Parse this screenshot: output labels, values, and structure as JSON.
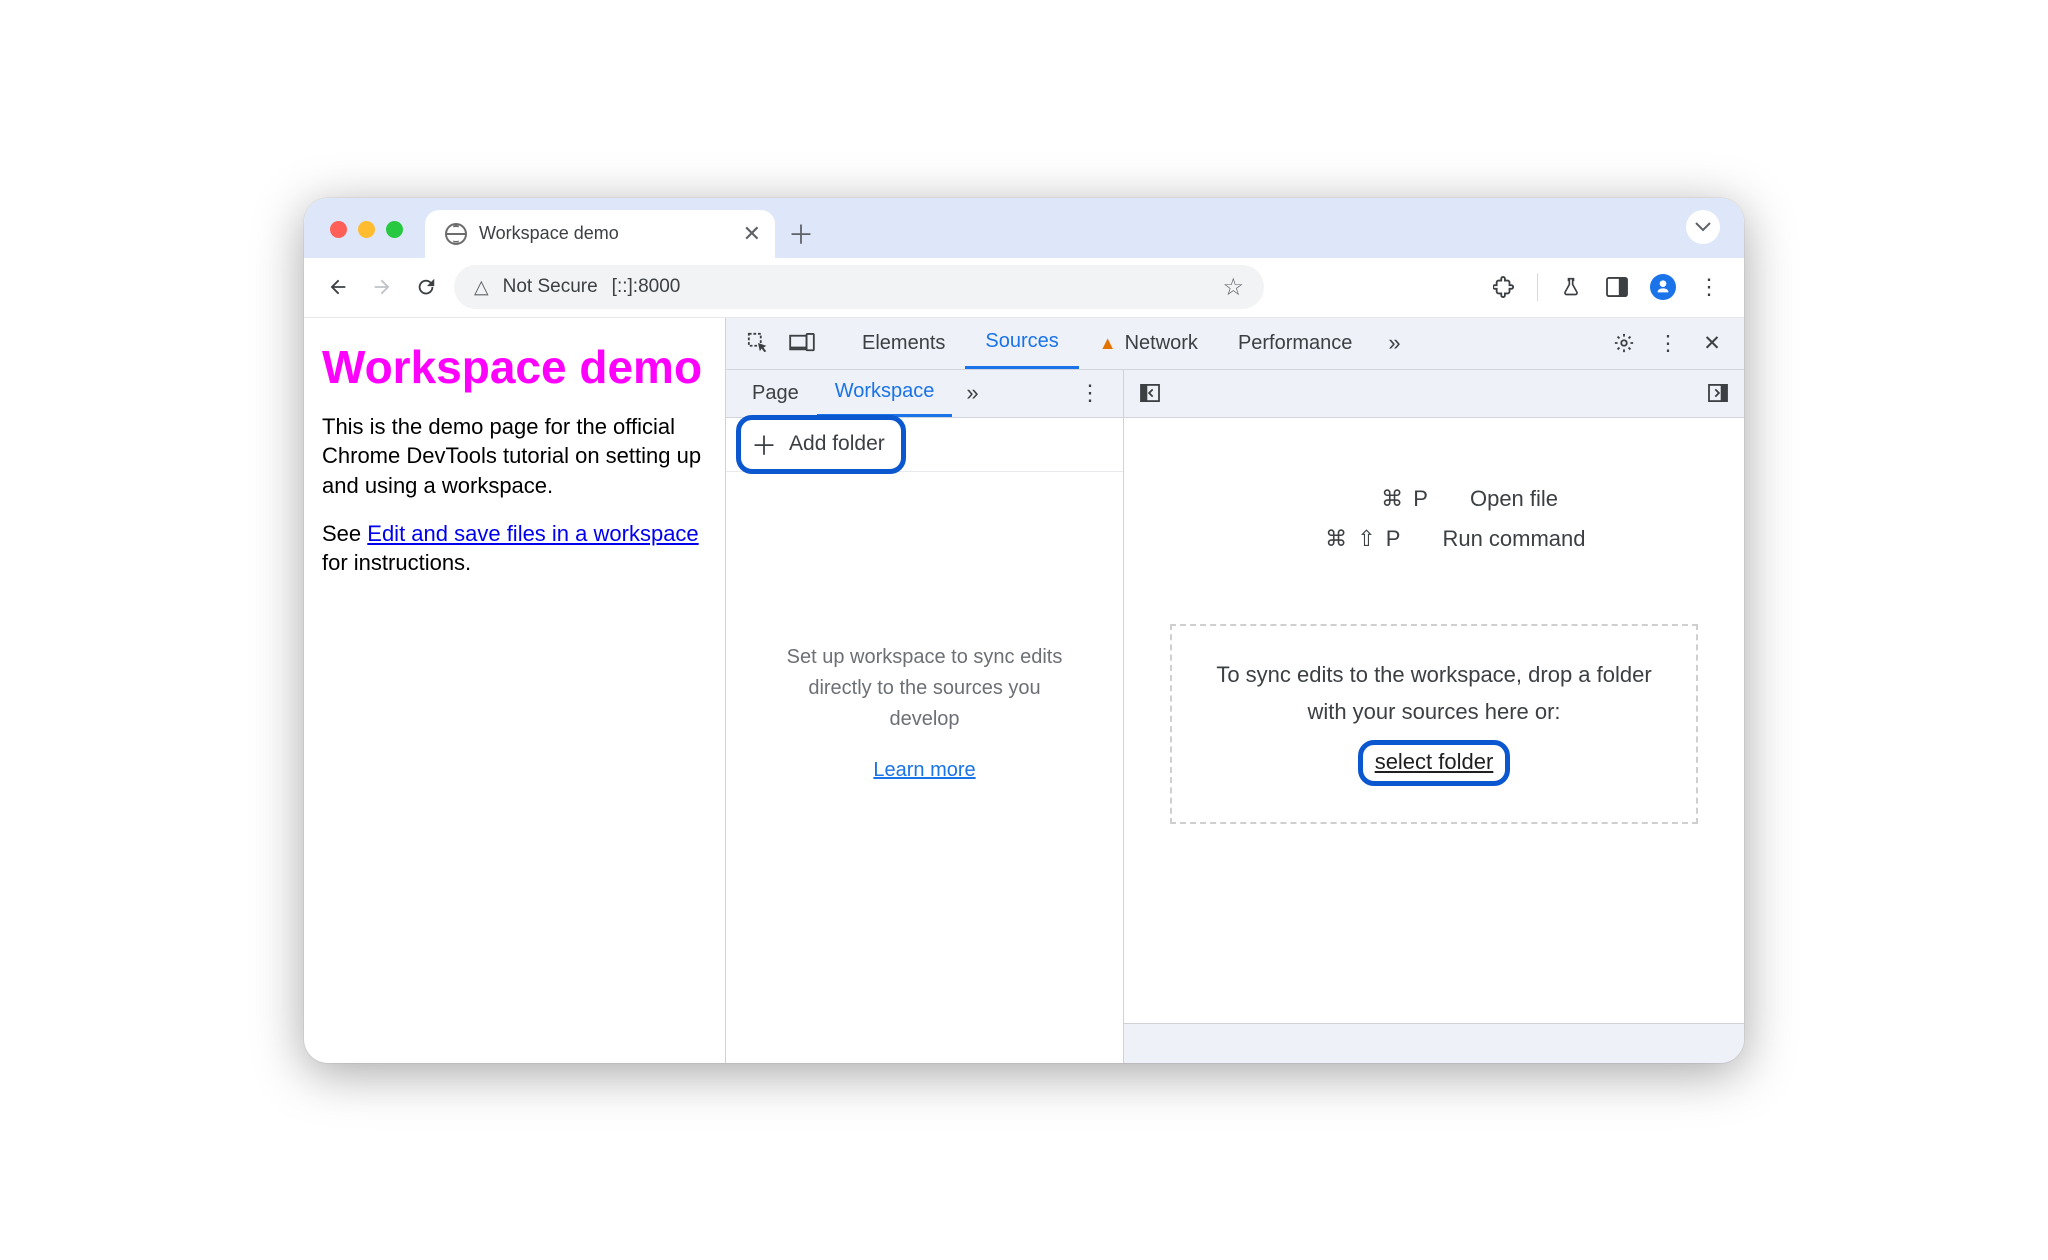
{
  "browser": {
    "tab_title": "Workspace demo",
    "security_label": "Not Secure",
    "url": "[::]:8000"
  },
  "page": {
    "heading": "Workspace demo",
    "para1": "This is the demo page for the official Chrome DevTools tutorial on setting up and using a workspace.",
    "para2_prefix": "See ",
    "para2_link": "Edit and save files in a workspace",
    "para2_suffix": " for instructions."
  },
  "devtools": {
    "tabs": {
      "elements": "Elements",
      "sources": "Sources",
      "network": "Network",
      "performance": "Performance"
    },
    "navigator": {
      "page_tab": "Page",
      "workspace_tab": "Workspace",
      "add_folder": "Add folder",
      "help_text": "Set up workspace to sync edits directly to the sources you develop",
      "learn_more": "Learn more"
    },
    "editor": {
      "open_file_shortcut": "⌘  P",
      "open_file_label": "Open file",
      "run_cmd_shortcut": "⌘  ⇧  P",
      "run_cmd_label": "Run command",
      "drop_text": "To sync edits to the workspace, drop a folder with your sources here or:",
      "select_folder": "select folder"
    }
  }
}
